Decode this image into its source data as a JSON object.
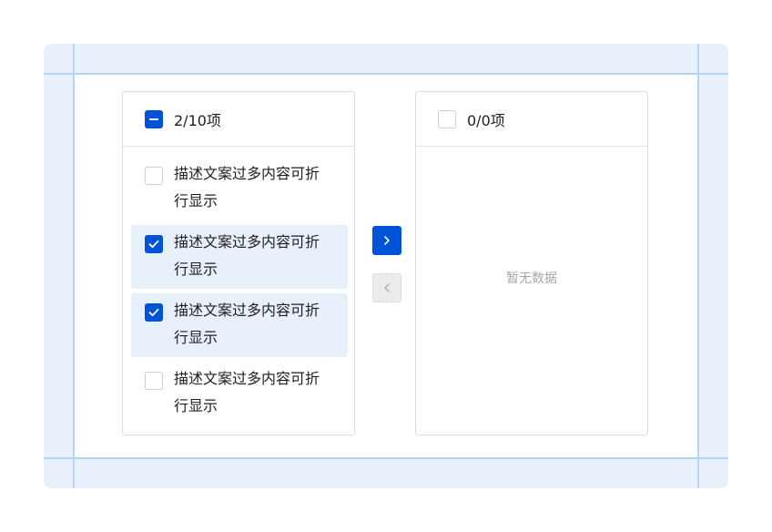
{
  "source_panel": {
    "count": "2/10项",
    "header_checkbox_state": "indeterminate",
    "items": [
      {
        "text": "描述文案过多内容可折行显示",
        "checked": false
      },
      {
        "text": "描述文案过多内容可折行显示",
        "checked": true
      },
      {
        "text": "描述文案过多内容可折行显示",
        "checked": true
      },
      {
        "text": "描述文案过多内容可折行显示",
        "checked": false
      }
    ]
  },
  "target_panel": {
    "count": "0/0项",
    "header_checkbox_state": "unchecked",
    "empty_text": "暂无数据"
  },
  "buttons": {
    "to_right_icon": "chevron-right-icon",
    "to_left_icon": "chevron-left-icon",
    "to_right_enabled": true,
    "to_left_enabled": false
  },
  "colors": {
    "accent": "#0052d9",
    "selected_row": "#e8f0fc",
    "guide_background": "#e8f0fc",
    "guide_line": "#b9d3f5"
  }
}
